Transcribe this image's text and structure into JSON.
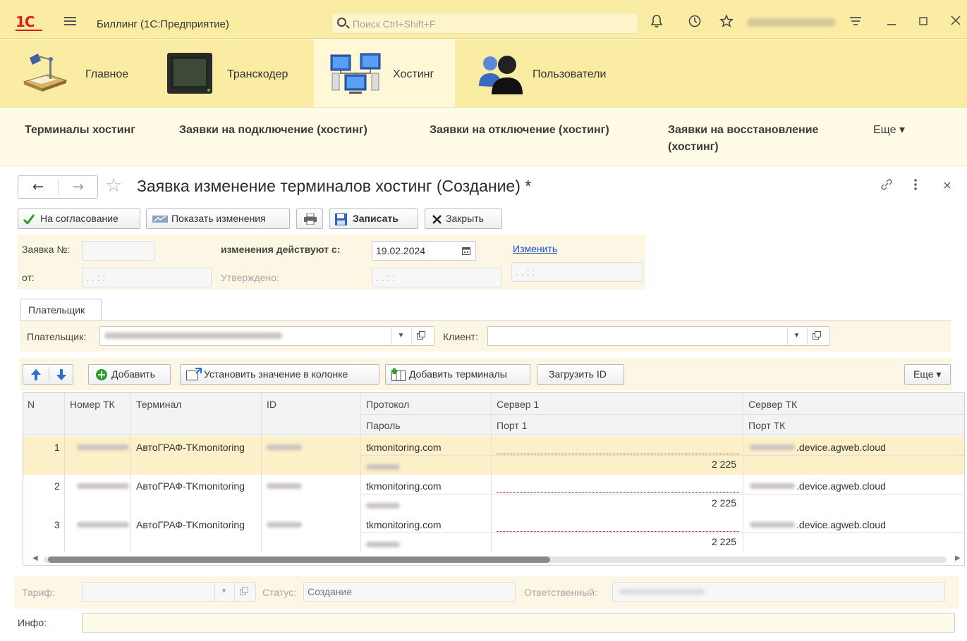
{
  "app": {
    "logo_text": "1С",
    "title": "Биллинг  (1С:Предприятие)",
    "search_placeholder": "Поиск Ctrl+Shift+F",
    "icons": [
      "menu-icon",
      "bell-icon",
      "history-icon",
      "star-icon",
      "settings-icon",
      "minimize-icon",
      "maximize-icon",
      "close-icon"
    ]
  },
  "sections": [
    {
      "label": "Главное",
      "icon": "desk-lamp-icon",
      "active": false
    },
    {
      "label": "Транскодер",
      "icon": "monitor-icon",
      "active": false
    },
    {
      "label": "Хостинг",
      "icon": "network-computers-icon",
      "active": true
    },
    {
      "label": "Пользователи",
      "icon": "users-icon",
      "active": false
    }
  ],
  "nav": {
    "links": [
      "Терминалы хостинг",
      "Заявки на подключение (хостинг)",
      "Заявки на отключение (хостинг)",
      "Заявки на восстановление",
      "(хостинг)"
    ],
    "more": "Еще ▾"
  },
  "form": {
    "title": "Заявка изменение терминалов хостинг (Создание) *",
    "commands": {
      "approve": "На согласование",
      "show_changes": "Показать изменения",
      "save": "Записать",
      "close": "Закрыть"
    },
    "header": {
      "number_label": "Заявка №:",
      "number_value": "",
      "from_label": "от:",
      "from_value": ".  .      :  :",
      "effective_label": "изменения действуют с:",
      "effective_value": "19.02.2024",
      "approved_label": "Утверждено:",
      "approved_value": ".  .      :  :",
      "change_link": "Изменить",
      "extra_value": ".  .      :  :"
    },
    "tab": "Плательщик",
    "payer_label": "Плательщик:",
    "client_label": "Клиент:",
    "client_value": ""
  },
  "table_toolbar": {
    "add": "Добавить",
    "set_value": "Установить значение в колонке",
    "add_terminals": "Добавить терминалы",
    "load_id": "Загрузить ID",
    "more": "Еще ▾"
  },
  "table": {
    "headers": {
      "n": "N",
      "tk_number": "Номер ТК",
      "terminal": "Терминал",
      "id": "ID",
      "protocol": "Протокол",
      "password": "Пароль",
      "server1": "Сервер 1",
      "port1": "Порт 1",
      "server_tk": "Сервер ТК",
      "port_tk": "Порт ТК"
    },
    "rows": [
      {
        "n": "1",
        "terminal": "АвтоГРАФ-TKmonitoring",
        "protocol": "tkmonitoring.com",
        "port1": "2 225",
        "server_tk": ".device.agweb.cloud",
        "selected": true
      },
      {
        "n": "2",
        "terminal": "АвтоГРАФ-TKmonitoring",
        "protocol": "tkmonitoring.com",
        "port1": "2 225",
        "server_tk": ".device.agweb.cloud",
        "selected": false
      },
      {
        "n": "3",
        "terminal": "АвтоГРАФ-TKmonitoring",
        "protocol": "tkmonitoring.com",
        "port1": "2 225",
        "server_tk": ".device.agweb.cloud",
        "selected": false
      }
    ]
  },
  "footer": {
    "tariff_label": "Тариф:",
    "status_label": "Статус:",
    "status_value": "Создание",
    "responsible_label": "Ответственный:",
    "info_label": "Инфо:",
    "info_value": ""
  }
}
